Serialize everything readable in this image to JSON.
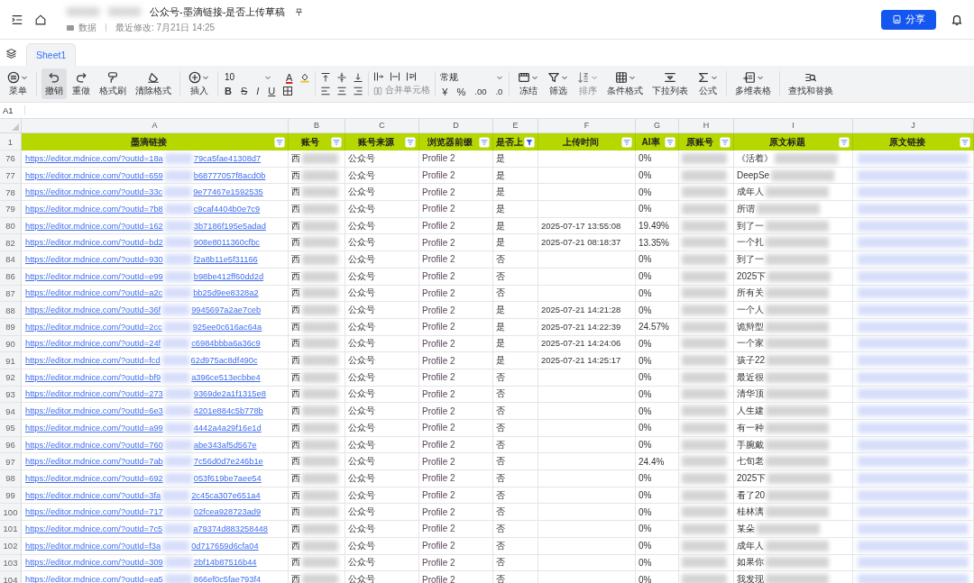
{
  "header": {
    "title": "公众号-墨滴链接-是否上传草稿",
    "folder": "数据",
    "modified": "最近修改: 7月21日 14:25",
    "share": "分享"
  },
  "sheet_tabs": [
    {
      "label": "Sheet1",
      "selected": true
    }
  ],
  "toolbar": {
    "groups": [
      {
        "kind": "buttons",
        "items": [
          {
            "label": "菜单",
            "selected": false,
            "disabled": false,
            "caret": true
          }
        ]
      },
      {
        "kind": "buttons",
        "items": [
          {
            "label": "撤销",
            "selected": true,
            "disabled": false,
            "caret": false
          },
          {
            "label": "重做",
            "selected": false,
            "disabled": false,
            "caret": false
          },
          {
            "label": "格式刷",
            "selected": false,
            "disabled": false,
            "caret": false
          },
          {
            "label": "清除格式",
            "selected": false,
            "disabled": false,
            "caret": false
          }
        ]
      },
      {
        "kind": "buttons",
        "items": [
          {
            "label": "插入",
            "selected": false,
            "disabled": false,
            "caret": true
          }
        ]
      },
      {
        "kind": "font",
        "size": "10",
        "color_letter": "A",
        "styles": [
          "B",
          "S",
          "I",
          "U"
        ]
      },
      {
        "kind": "align"
      },
      {
        "kind": "merge",
        "label": "合并单元格",
        "disabled": true
      },
      {
        "kind": "number",
        "format": "常规",
        "currency": "¥",
        "percent": "%",
        "more_decimals": ".00",
        "fewer_decimals": ".0"
      },
      {
        "kind": "buttons",
        "items": [
          {
            "label": "冻结",
            "selected": false,
            "disabled": false,
            "caret": true
          },
          {
            "label": "筛选",
            "selected": false,
            "disabled": false,
            "caret": true
          },
          {
            "label": "排序",
            "selected": false,
            "disabled": true,
            "caret": true
          },
          {
            "label": "条件格式",
            "selected": false,
            "disabled": false,
            "caret": true
          },
          {
            "label": "下拉列表",
            "selected": false,
            "disabled": false,
            "caret": false
          },
          {
            "label": "公式",
            "selected": false,
            "disabled": false,
            "caret": true
          }
        ]
      },
      {
        "kind": "buttons",
        "items": [
          {
            "label": "多维表格",
            "selected": false,
            "disabled": false,
            "caret": true
          }
        ]
      },
      {
        "kind": "buttons",
        "items": [
          {
            "label": "查找和替换",
            "selected": false,
            "disabled": false,
            "caret": false
          }
        ]
      }
    ]
  },
  "formula_bar": {
    "cell": "A1"
  },
  "columns": [
    "A",
    "B",
    "C",
    "D",
    "E",
    "F",
    "G",
    "H",
    "I",
    "J"
  ],
  "header_row": {
    "number": "1",
    "cells": [
      {
        "label": "墨滴链接",
        "filtered": false
      },
      {
        "label": "账号",
        "filtered": false
      },
      {
        "label": "账号来源",
        "filtered": false
      },
      {
        "label": "浏览器前缀",
        "filtered": false
      },
      {
        "label": "是否上",
        "filtered": true
      },
      {
        "label": "上传时间",
        "filtered": false
      },
      {
        "label": "AI率",
        "filtered": false
      },
      {
        "label": "原账号",
        "filtered": false
      },
      {
        "label": "原文标题",
        "filtered": false
      },
      {
        "label": "原文链接",
        "filtered": false
      }
    ]
  },
  "rows": [
    {
      "number": "76",
      "url_start": "https://editor.mdnice.com/?outId=18a",
      "url_end": "79ca5fae41308d7",
      "account": "西",
      "source": "公众号",
      "browser": "Profile 2",
      "uploaded": "是",
      "ai_rate": "0%",
      "title": "《活着》"
    },
    {
      "number": "77",
      "url_start": "https://editor.mdnice.com/?outId=659",
      "url_end": "b68777057f8acd0b",
      "account": "西",
      "source": "公众号",
      "browser": "Profile 2",
      "uploaded": "是",
      "ai_rate": "0%",
      "title": "DeepSe"
    },
    {
      "number": "78",
      "url_start": "https://editor.mdnice.com/?outId=33c",
      "url_end": "9e77467e1592535",
      "account": "西",
      "source": "公众号",
      "browser": "Profile 2",
      "uploaded": "是",
      "ai_rate": "0%",
      "title": "成年人"
    },
    {
      "number": "79",
      "url_start": "https://editor.mdnice.com/?outId=7b8",
      "url_end": "c9caf4404b0e7c9",
      "account": "西",
      "source": "公众号",
      "browser": "Profile 2",
      "uploaded": "是",
      "ai_rate": "0%",
      "title": "所谓"
    },
    {
      "number": "80",
      "url_start": "https://editor.mdnice.com/?outId=162",
      "url_end": "3b7186f195e5adad",
      "account": "西",
      "source": "公众号",
      "browser": "Profile 2",
      "uploaded": "是",
      "time": "2025-07-17 13:55:08",
      "ai_rate": "19.49%",
      "title": "到了一"
    },
    {
      "number": "82",
      "url_start": "https://editor.mdnice.com/?outId=bd2",
      "url_end": "908e8011360cfbc",
      "account": "西",
      "source": "公众号",
      "browser": "Profile 2",
      "uploaded": "是",
      "time": "2025-07-21 08:18:37",
      "ai_rate": "13.35%",
      "title": "一个扎"
    },
    {
      "number": "84",
      "url_start": "https://editor.mdnice.com/?outId=930",
      "url_end": "f2a8b11e5f31166",
      "account": "西",
      "source": "公众号",
      "browser": "Profile 2",
      "uploaded": "否",
      "ai_rate": "0%",
      "title": "到了一"
    },
    {
      "number": "86",
      "url_start": "https://editor.mdnice.com/?outId=e99",
      "url_end": "b98be412ff60dd2d",
      "account": "西",
      "source": "公众号",
      "browser": "Profile 2",
      "uploaded": "否",
      "ai_rate": "0%",
      "title": "2025下"
    },
    {
      "number": "87",
      "url_start": "https://editor.mdnice.com/?outId=a2c",
      "url_end": "bb25d9ee8328a2",
      "account": "西",
      "source": "公众号",
      "browser": "Profile 2",
      "uploaded": "否",
      "ai_rate": "0%",
      "title": "所有关"
    },
    {
      "number": "88",
      "url_start": "https://editor.mdnice.com/?outId=36f",
      "url_end": "9945697a2ae7ceb",
      "account": "西",
      "source": "公众号",
      "browser": "Profile 2",
      "uploaded": "是",
      "time": "2025-07-21 14:21:28",
      "ai_rate": "0%",
      "title": "一个人"
    },
    {
      "number": "89",
      "url_start": "https://editor.mdnice.com/?outId=2cc",
      "url_end": "925ee0c616ac64a",
      "account": "西",
      "source": "公众号",
      "browser": "Profile 2",
      "uploaded": "是",
      "time": "2025-07-21 14:22:39",
      "ai_rate": "24.57%",
      "title": "诡辩型"
    },
    {
      "number": "90",
      "url_start": "https://editor.mdnice.com/?outId=24f",
      "url_end": "c6984bbba6a36c9",
      "account": "西",
      "source": "公众号",
      "browser": "Profile 2",
      "uploaded": "是",
      "time": "2025-07-21 14:24:06",
      "ai_rate": "0%",
      "title": "一个家"
    },
    {
      "number": "91",
      "url_start": "https://editor.mdnice.com/?outId=fcd",
      "url_end": "62d975ac8df490c",
      "account": "西",
      "source": "公众号",
      "browser": "Profile 2",
      "uploaded": "是",
      "time": "2025-07-21 14:25:17",
      "ai_rate": "0%",
      "title": "孩子22"
    },
    {
      "number": "92",
      "url_start": "https://editor.mdnice.com/?outId=bf9",
      "url_end": "a396ce513ecbbe4",
      "account": "西",
      "source": "公众号",
      "browser": "Profile 2",
      "uploaded": "否",
      "ai_rate": "0%",
      "title": "最近很"
    },
    {
      "number": "93",
      "url_start": "https://editor.mdnice.com/?outId=273",
      "url_end": "9369de2a1f1315e8",
      "account": "西",
      "source": "公众号",
      "browser": "Profile 2",
      "uploaded": "否",
      "ai_rate": "0%",
      "title": "清华顶"
    },
    {
      "number": "94",
      "url_start": "https://editor.mdnice.com/?outId=6e3",
      "url_end": "4201e884c5b778b",
      "account": "西",
      "source": "公众号",
      "browser": "Profile 2",
      "uploaded": "否",
      "ai_rate": "0%",
      "title": "人生建"
    },
    {
      "number": "95",
      "url_start": "https://editor.mdnice.com/?outId=a99",
      "url_end": "4442a4a29f16e1d",
      "account": "西",
      "source": "公众号",
      "browser": "Profile 2",
      "uploaded": "否",
      "ai_rate": "0%",
      "title": "有一种"
    },
    {
      "number": "96",
      "url_start": "https://editor.mdnice.com/?outId=760",
      "url_end": "abe343af5d567e",
      "account": "西",
      "source": "公众号",
      "browser": "Profile 2",
      "uploaded": "否",
      "ai_rate": "0%",
      "title": "手腕戴"
    },
    {
      "number": "97",
      "url_start": "https://editor.mdnice.com/?outId=7ab",
      "url_end": "7c56d0d7e246b1e",
      "account": "西",
      "source": "公众号",
      "browser": "Profile 2",
      "uploaded": "否",
      "ai_rate": "24.4%",
      "title": "七旬老"
    },
    {
      "number": "98",
      "url_start": "https://editor.mdnice.com/?outId=692",
      "url_end": "053f619be7aee54",
      "account": "西",
      "source": "公众号",
      "browser": "Profile 2",
      "uploaded": "否",
      "ai_rate": "0%",
      "title": "2025下"
    },
    {
      "number": "99",
      "url_start": "https://editor.mdnice.com/?outId=3fa",
      "url_end": "2c45ca307e651a4",
      "account": "西",
      "source": "公众号",
      "browser": "Profile 2",
      "uploaded": "否",
      "ai_rate": "0%",
      "title": "看了20"
    },
    {
      "number": "100",
      "url_start": "https://editor.mdnice.com/?outId=717",
      "url_end": "02fcea928723ad9",
      "account": "西",
      "source": "公众号",
      "browser": "Profile 2",
      "uploaded": "否",
      "ai_rate": "0%",
      "title": "桂林漓"
    },
    {
      "number": "101",
      "url_start": "https://editor.mdnice.com/?outId=7c5",
      "url_end": "a79374d883258448",
      "account": "西",
      "source": "公众号",
      "browser": "Profile 2",
      "uploaded": "否",
      "ai_rate": "0%",
      "title": "某朵"
    },
    {
      "number": "102",
      "url_start": "https://editor.mdnice.com/?outId=f3a",
      "url_end": "0d717659d6cfa04",
      "account": "西",
      "source": "公众号",
      "browser": "Profile 2",
      "uploaded": "否",
      "ai_rate": "0%",
      "title": "成年人"
    },
    {
      "number": "103",
      "url_start": "https://editor.mdnice.com/?outId=309",
      "url_end": "2bf14b87516b44",
      "account": "西",
      "source": "公众号",
      "browser": "Profile 2",
      "uploaded": "否",
      "ai_rate": "0%",
      "title": "如果你"
    },
    {
      "number": "104",
      "url_start": "https://editor.mdnice.com/?outId=ea5",
      "url_end": "866ef0c5fae793f4",
      "account": "西",
      "source": "公众号",
      "browser": "Profile 2",
      "uploaded": "否",
      "ai_rate": "0%",
      "title": "我发现"
    }
  ]
}
